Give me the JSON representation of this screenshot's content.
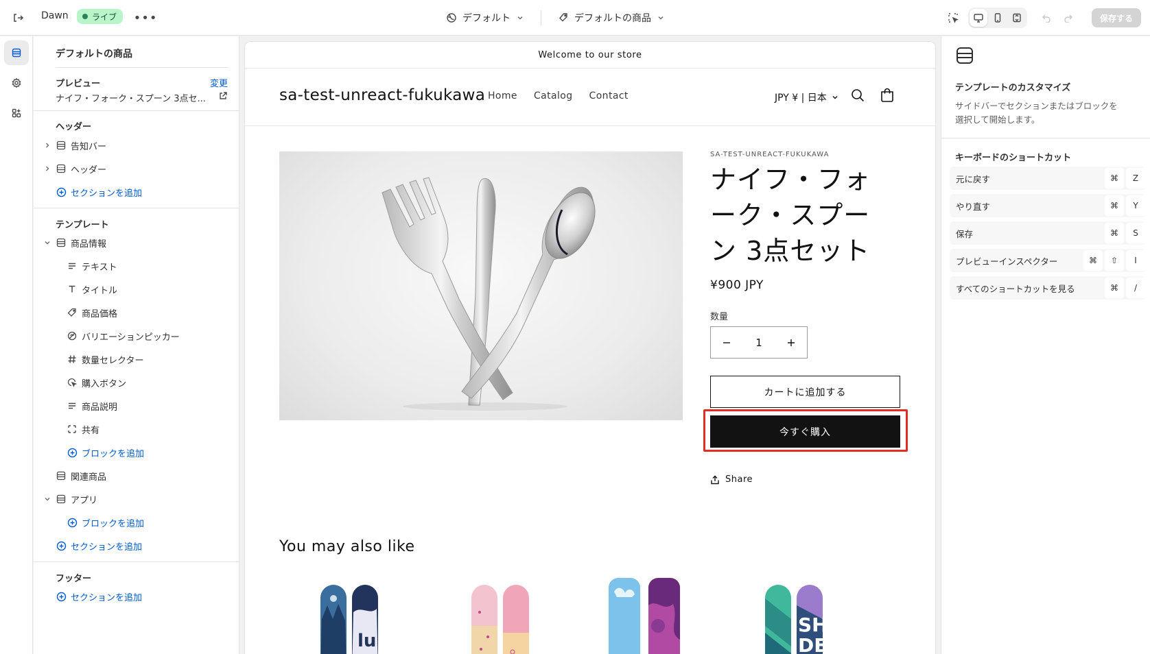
{
  "topbar": {
    "theme_name": "Dawn",
    "live_badge": "ライブ",
    "more": "•••",
    "template_select": "デフォルト",
    "product_select": "デフォルトの商品",
    "save_label": "保存する"
  },
  "sidebar": {
    "title": "デフォルトの商品",
    "preview_heading": "プレビュー",
    "preview_change": "変更",
    "preview_value": "ナイフ・フォーク・スプーン 3点セ...",
    "header_group": "ヘッダー",
    "header_items": [
      "告知バー",
      "ヘッダー"
    ],
    "add_section": "セクションを追加",
    "template_group": "テンプレート",
    "product_info": "商品情報",
    "blocks": [
      "テキスト",
      "タイトル",
      "商品価格",
      "バリエーションピッカー",
      "数量セレクター",
      "購入ボタン",
      "商品説明",
      "共有"
    ],
    "add_block": "ブロックを追加",
    "related": "関連商品",
    "apps": "アプリ",
    "footer_group": "フッター"
  },
  "store": {
    "announcement": "Welcome to our store",
    "logo": "sa-test-unreact-fukukawa",
    "nav": [
      "Home",
      "Catalog",
      "Contact"
    ],
    "currency": "JPY ¥ | 日本",
    "vendor": "SA-TEST-UNREACT-FUKUKAWA",
    "product_title": "ナイフ・フォーク・スプーン 3点セット",
    "price": "¥900 JPY",
    "quantity_label": "数量",
    "quantity_value": "1",
    "add_to_cart": "カートに追加する",
    "buy_now": "今すぐ購入",
    "share": "Share",
    "also_like": "You may also like"
  },
  "rpanel": {
    "title": "テンプレートのカスタマイズ",
    "desc": "サイドバーでセクションまたはブロックを選択して開始します。",
    "kb_heading": "キーボードのショートカット",
    "shortcuts": [
      {
        "label": "元に戻す",
        "keys": [
          "⌘",
          "Z"
        ]
      },
      {
        "label": "やり直す",
        "keys": [
          "⌘",
          "Y"
        ]
      },
      {
        "label": "保存",
        "keys": [
          "⌘",
          "S"
        ]
      },
      {
        "label": "プレビューインスペクター",
        "keys": [
          "⌘",
          "⇧",
          "I"
        ]
      },
      {
        "label": "すべてのショートカットを見る",
        "keys": [
          "⌘",
          "/"
        ]
      }
    ]
  },
  "colors": {
    "accent": "#005bd3",
    "live_bg": "#b9f5c9",
    "highlight": "#e02f22",
    "buy_bg": "#121212"
  }
}
